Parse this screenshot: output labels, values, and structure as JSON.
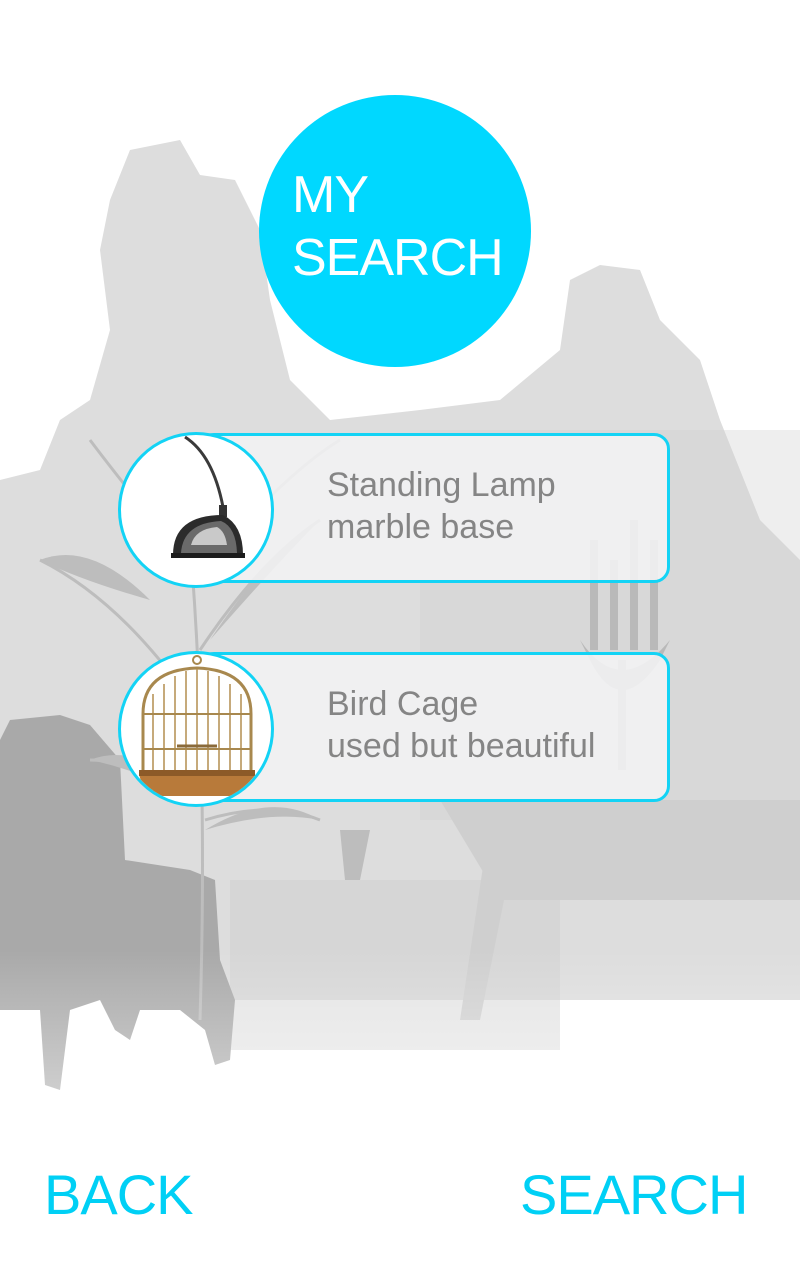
{
  "header": {
    "title_line1": "MY",
    "title_line2": "SEARCH"
  },
  "results": [
    {
      "title": "Standing Lamp",
      "subtitle": "marble base",
      "icon": "lamp-thumbnail"
    },
    {
      "title": "Bird Cage",
      "subtitle": "used but beautiful",
      "icon": "birdcage-thumbnail"
    }
  ],
  "footer": {
    "back_label": "BACK",
    "search_label": "SEARCH"
  },
  "colors": {
    "accent": "#00d8ff",
    "text_muted": "#858585",
    "shadow": "#c8c8c8"
  }
}
